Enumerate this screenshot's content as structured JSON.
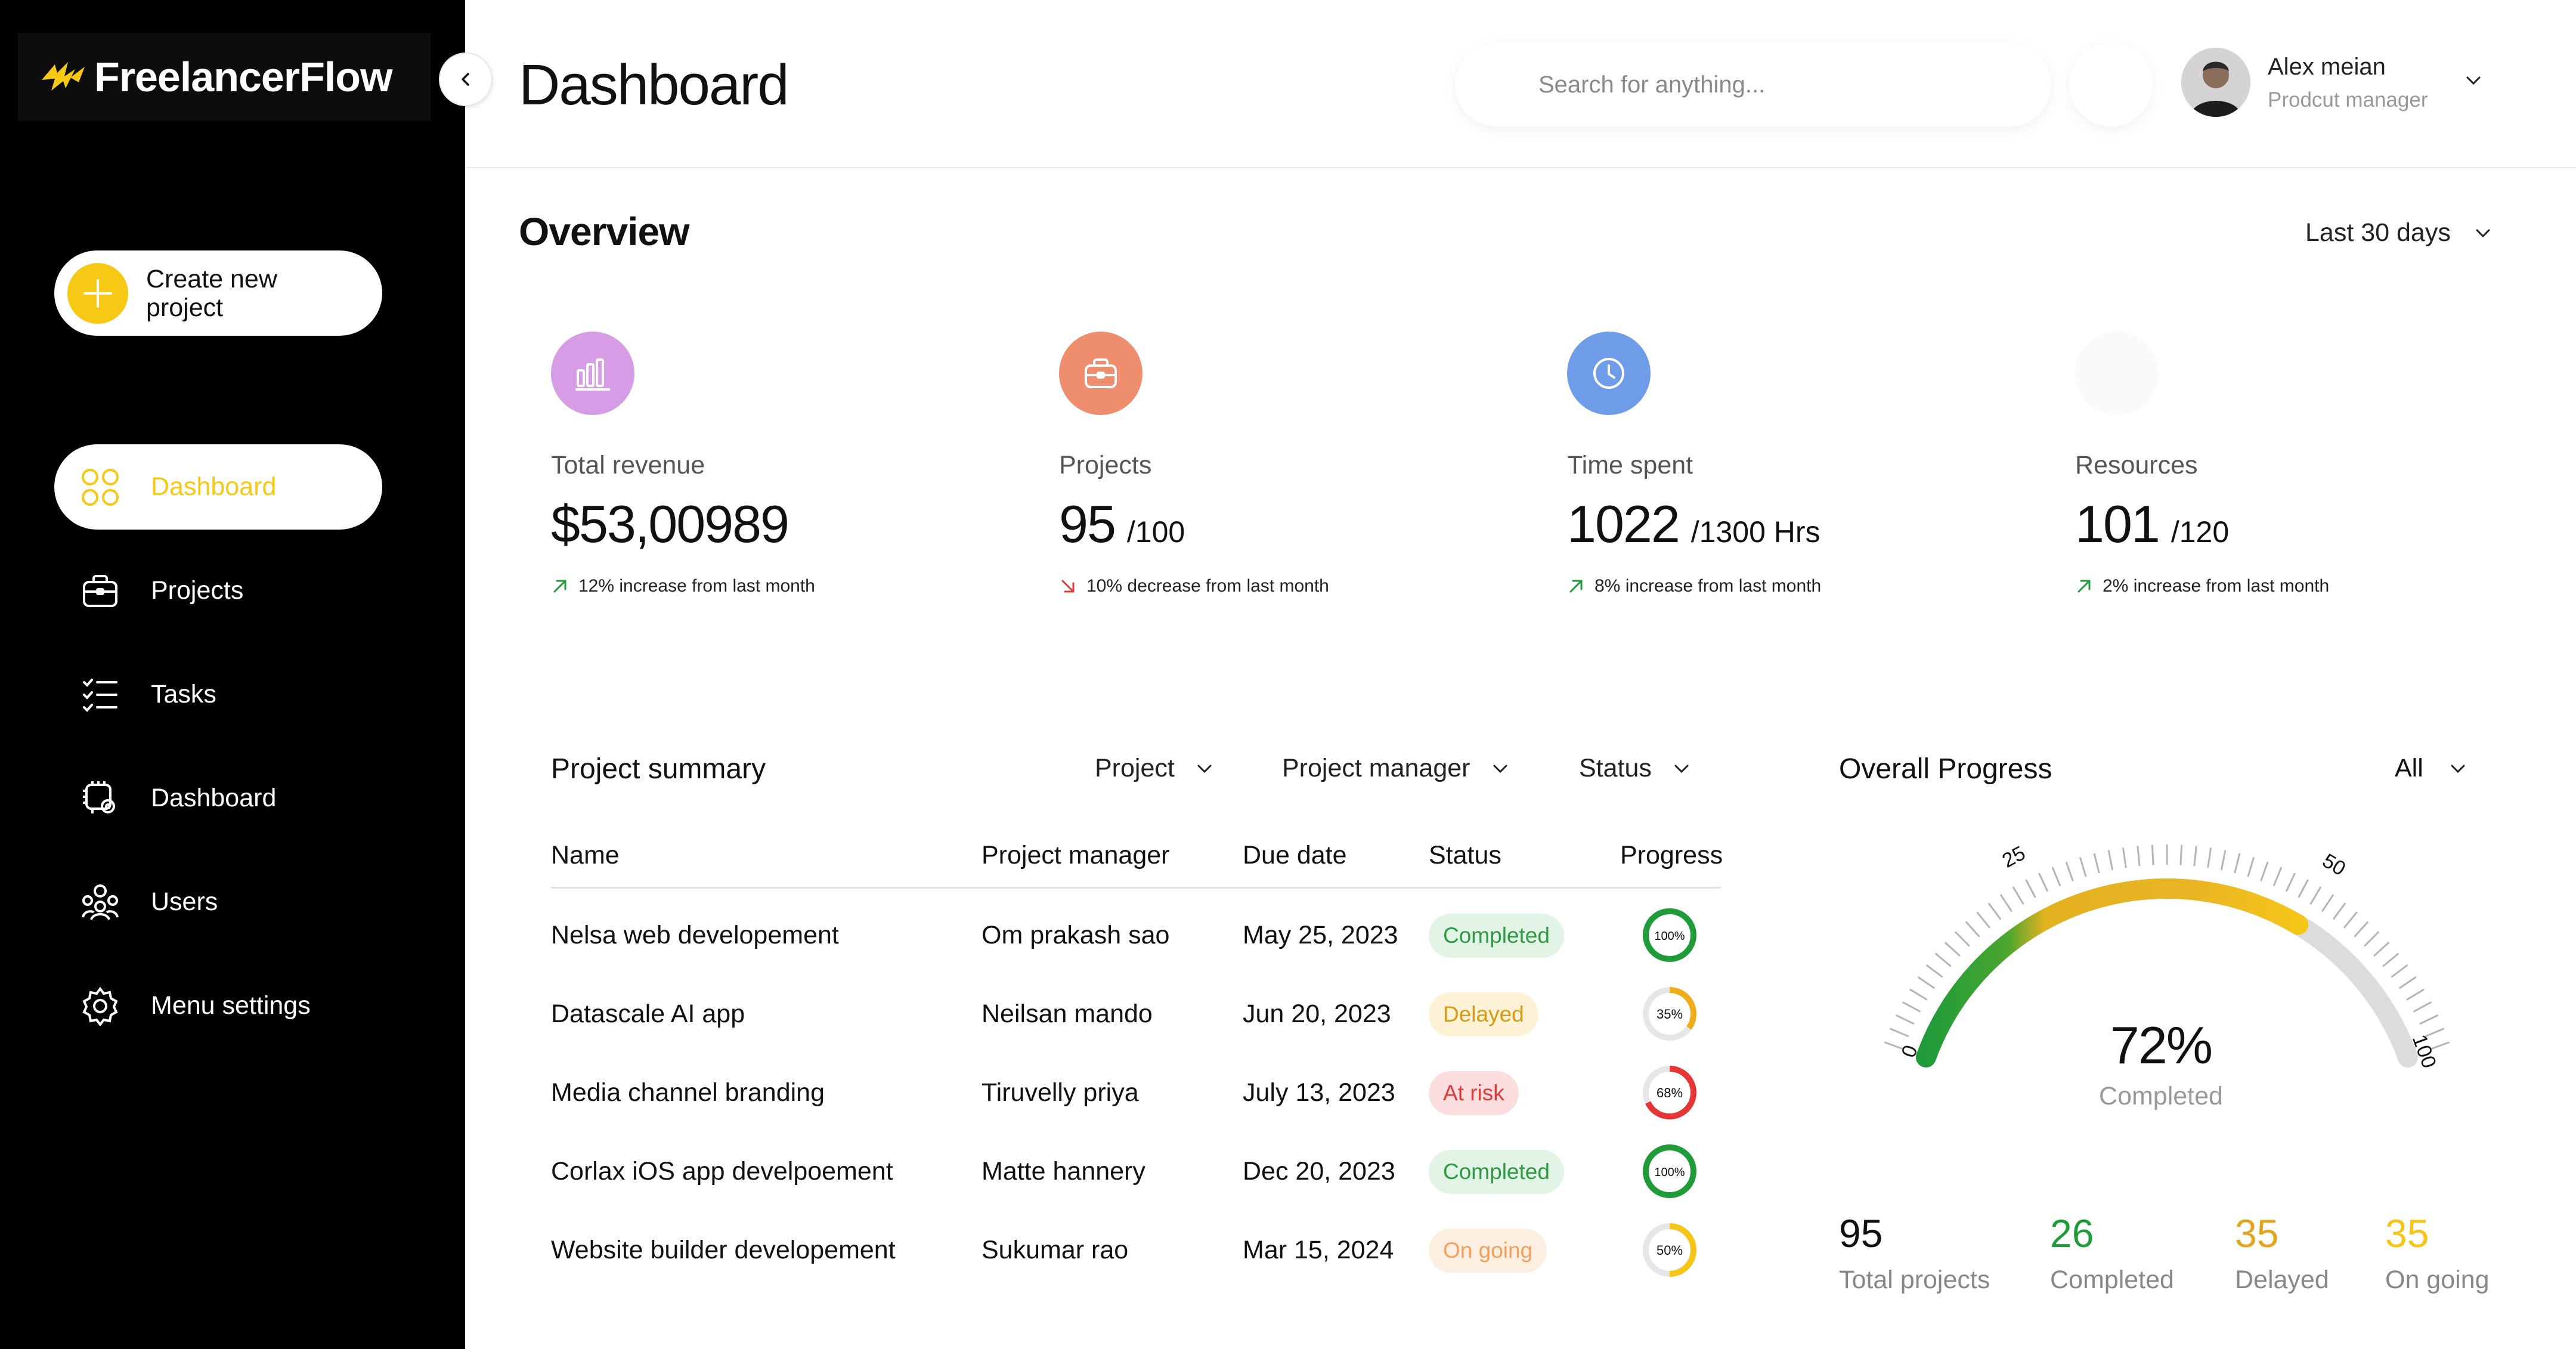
{
  "app": {
    "name": "FreelancerFlow"
  },
  "sidebar": {
    "create_label": "Create new project",
    "items": [
      {
        "label": "Dashboard",
        "icon": "grid-icon",
        "active": true
      },
      {
        "label": "Projects",
        "icon": "briefcase-icon",
        "active": false
      },
      {
        "label": "Tasks",
        "icon": "checklist-icon",
        "active": false
      },
      {
        "label": "Dashboard",
        "icon": "gear-chip-icon",
        "active": false
      },
      {
        "label": "Users",
        "icon": "users-icon",
        "active": false
      },
      {
        "label": "Menu settings",
        "icon": "gear-icon",
        "active": false
      }
    ]
  },
  "header": {
    "title": "Dashboard",
    "search_placeholder": "Search for anything...",
    "user": {
      "name": "Alex meian",
      "role": "Prodcut manager"
    }
  },
  "overview": {
    "title": "Overview",
    "range": "Last 30 days",
    "stats": [
      {
        "label": "Total revenue",
        "value": "$53,00989",
        "sub": "",
        "trend": "12% increase from last month",
        "direction": "up",
        "icon": "bar-chart-icon",
        "color": "#d69ce6"
      },
      {
        "label": "Projects",
        "value": "95",
        "sub": "/100",
        "trend": "10% decrease from last month",
        "direction": "down",
        "icon": "briefcase-icon",
        "color": "#ee8e6f"
      },
      {
        "label": "Time spent",
        "value": "1022",
        "sub": "/1300 Hrs",
        "trend": "8% increase from last month",
        "direction": "up",
        "icon": "clock-icon",
        "color": "#6f9ce8"
      },
      {
        "label": "Resources",
        "value": "101",
        "sub": "/120",
        "trend": "2% increase from last month",
        "direction": "up",
        "icon": "resources-icon",
        "color": "#fafafa"
      }
    ]
  },
  "project_summary": {
    "title": "Project summary",
    "filters": [
      "Project",
      "Project manager",
      "Status"
    ],
    "columns": [
      "Name",
      "Project manager",
      "Due date",
      "Status",
      "Progress"
    ],
    "rows": [
      {
        "name": "Nelsa web developement",
        "manager": "Om prakash sao",
        "due": "May 25, 2023",
        "status": "Completed",
        "progress": 100,
        "progress_label": "100%"
      },
      {
        "name": "Datascale AI app",
        "manager": "Neilsan mando",
        "due": "Jun 20, 2023",
        "status": "Delayed",
        "progress": 35,
        "progress_label": "35%"
      },
      {
        "name": "Media channel branding",
        "manager": "Tiruvelly priya",
        "due": "July 13, 2023",
        "status": "At risk",
        "progress": 68,
        "progress_label": "68%"
      },
      {
        "name": "Corlax iOS app develpoement",
        "manager": "Matte hannery",
        "due": "Dec 20, 2023",
        "status": "Completed",
        "progress": 100,
        "progress_label": "100%"
      },
      {
        "name": "Website builder developement",
        "manager": "Sukumar rao",
        "due": "Mar 15, 2024",
        "status": "On going",
        "progress": 50,
        "progress_label": "50%"
      }
    ],
    "status_colors": {
      "Completed": {
        "bg": "#e2f4e6",
        "fg": "#2f9a44",
        "ring": "#1f9b3a"
      },
      "Delayed": {
        "bg": "#fdf2d6",
        "fg": "#d79a13",
        "ring": "#f0ad1a"
      },
      "At risk": {
        "bg": "#fcdede",
        "fg": "#e03b3b",
        "ring": "#e53535"
      },
      "On going": {
        "bg": "#fdeee2",
        "fg": "#f2a15d",
        "ring": "#f5c518"
      }
    }
  },
  "overall_progress": {
    "title": "Overall Progress",
    "filter": "All",
    "percent": "72%",
    "percent_label": "Completed",
    "gauge_value": 72,
    "scale_labels": [
      "0",
      "25",
      "50",
      "100"
    ],
    "stats": [
      {
        "value": "95",
        "label": "Total projects",
        "color": "#111111"
      },
      {
        "value": "26",
        "label": "Completed",
        "color": "#1f9b3a"
      },
      {
        "value": "35",
        "label": "Delayed",
        "color": "#e3a51f"
      },
      {
        "value": "35",
        "label": "On going",
        "color": "#f5c518"
      }
    ]
  },
  "colors": {
    "accent": "#f6c915",
    "sidebar_bg": "#000000"
  }
}
